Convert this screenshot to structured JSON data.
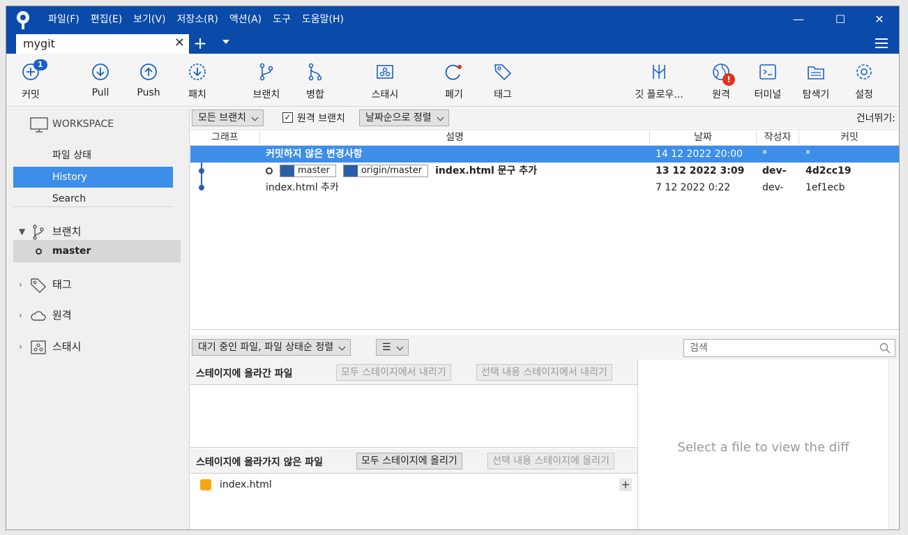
{
  "titlebar": {
    "menu": [
      "파일(F)",
      "편집(E)",
      "보기(V)",
      "저장소(R)",
      "액션(A)",
      "도구",
      "도움말(H)"
    ],
    "minimize": "—",
    "maximize": "☐",
    "close": "✕"
  },
  "tabs": {
    "active": "mygit",
    "close": "✕",
    "add": "+"
  },
  "toolbar": {
    "commit": "커밋",
    "commit_badge": "1",
    "pull": "Pull",
    "push": "Push",
    "fetch": "패치",
    "branch": "브랜치",
    "merge": "병합",
    "stash": "스태시",
    "discard": "폐기",
    "tag": "태그",
    "gitflow": "깃 플로우...",
    "remote": "원격",
    "remote_alert": "!",
    "terminal": "터미널",
    "explorer": "탐색기",
    "settings": "설정"
  },
  "sidebar": {
    "workspace": "WORKSPACE",
    "items": [
      "파일 상태",
      "History",
      "Search"
    ],
    "active_item": "History",
    "branches": "브랜치",
    "branch_current": "master",
    "tags": "태그",
    "remotes": "원격",
    "stashes": "스태시"
  },
  "history": {
    "filter_branches": "모든 브랜치",
    "remote_branches_label": "원격 브랜치",
    "remote_branches_checked": true,
    "sort": "날짜순으로 정렬",
    "skip": "건너뛰기:",
    "columns": [
      "그래프",
      "설명",
      "날짜",
      "작성자",
      "커밋"
    ],
    "rows": [
      {
        "desc": "커밋하지 않은 변경사항",
        "date": "14 12 2022 20:00",
        "author": "*",
        "commit": "*"
      },
      {
        "refs": [
          "master",
          "origin/master"
        ],
        "desc": "index.html 문구 추가",
        "date": "13 12 2022 3:09",
        "author": "dev-",
        "commit": "4d2cc19"
      },
      {
        "desc": "index.html 추카",
        "date": "7 12 2022 0:22",
        "author": "dev-",
        "commit": "1ef1ecb"
      }
    ]
  },
  "files": {
    "pending_sort": "대기 중인 파일, 파일 상태순 정렬",
    "view_mode": "☰",
    "search_placeholder": "검색",
    "staged_title": "스테이지에 올라간 파일",
    "unstage_all": "모두 스테이지에서 내리기",
    "unstage_selected": "선택 내용 스테이지에서 내리기",
    "unstaged_title": "스테이지에 올라가지 않은 파일",
    "stage_all": "모두 스테이지에 올리기",
    "stage_selected": "선택 내용 스테이지에 올리기",
    "unstaged_files": [
      "index.html"
    ],
    "diff_placeholder": "Select a file to view the diff"
  }
}
